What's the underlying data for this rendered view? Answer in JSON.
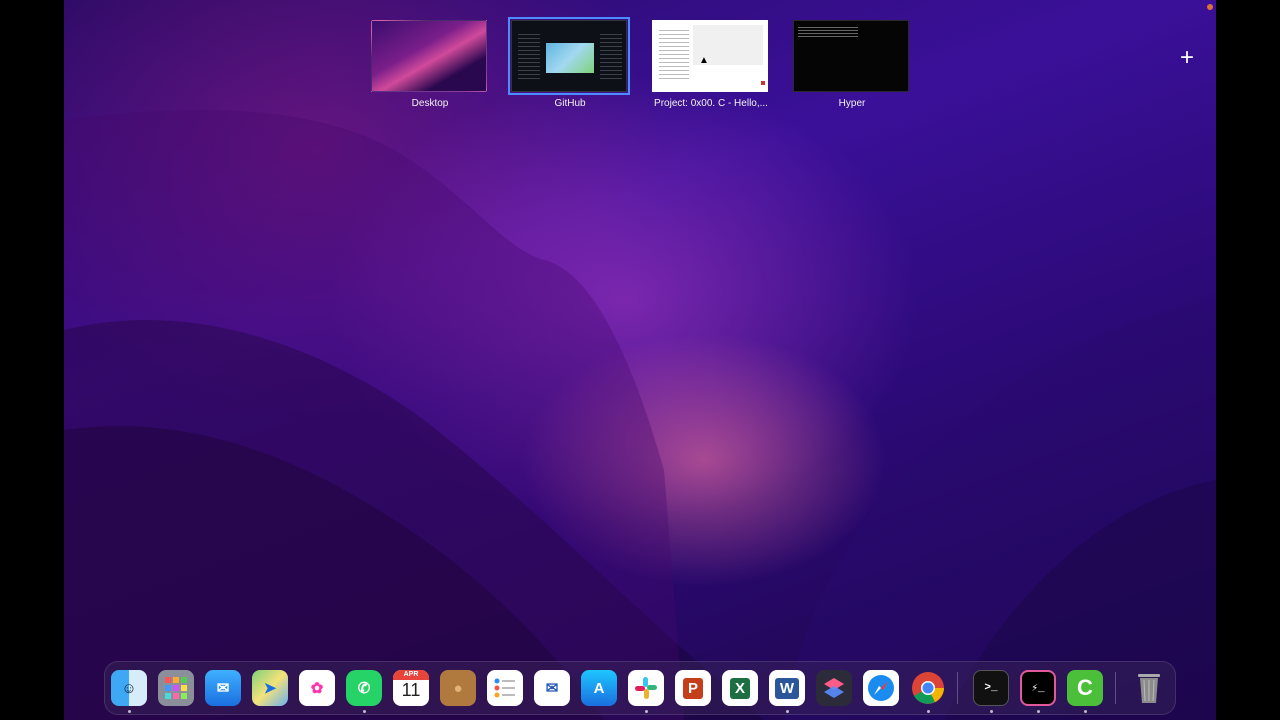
{
  "spaces": [
    {
      "label": "Desktop",
      "active": false
    },
    {
      "label": "GitHub",
      "active": true
    },
    {
      "label": "Project: 0x00. C - Hello,...",
      "active": false
    },
    {
      "label": "Hyper",
      "active": false
    }
  ],
  "add_space_label": "+",
  "dock": {
    "items": [
      {
        "name": "finder-icon",
        "running": true
      },
      {
        "name": "launchpad-icon",
        "running": false
      },
      {
        "name": "mail-icon",
        "running": false
      },
      {
        "name": "maps-icon",
        "running": false
      },
      {
        "name": "photos-icon",
        "running": false
      },
      {
        "name": "whatsapp-icon",
        "running": true
      },
      {
        "name": "calendar-icon",
        "running": false
      },
      {
        "name": "contacts-icon",
        "running": false
      },
      {
        "name": "reminders-icon",
        "running": false
      },
      {
        "name": "airmail-icon",
        "running": false
      },
      {
        "name": "app-store-icon",
        "running": false
      },
      {
        "name": "slack-icon",
        "running": true
      },
      {
        "name": "powerpoint-icon",
        "running": false
      },
      {
        "name": "excel-icon",
        "running": false
      },
      {
        "name": "word-icon",
        "running": true
      },
      {
        "name": "shortcuts-icon",
        "running": false
      },
      {
        "name": "safari-icon",
        "running": false
      },
      {
        "name": "chrome-icon",
        "running": true
      },
      {
        "name": "terminal-icon",
        "running": true
      },
      {
        "name": "hyper-icon",
        "running": true
      },
      {
        "name": "camtasia-icon",
        "running": true
      },
      {
        "name": "trash-icon",
        "running": false
      }
    ],
    "calendar": {
      "month": "APR",
      "day": "11"
    },
    "powerpoint_letter": "P",
    "excel_letter": "X",
    "word_letter": "W",
    "terminal_prompt": ">_",
    "hyper_prompt": "⚡_"
  },
  "colors": {
    "accent": "#4d8cff"
  }
}
